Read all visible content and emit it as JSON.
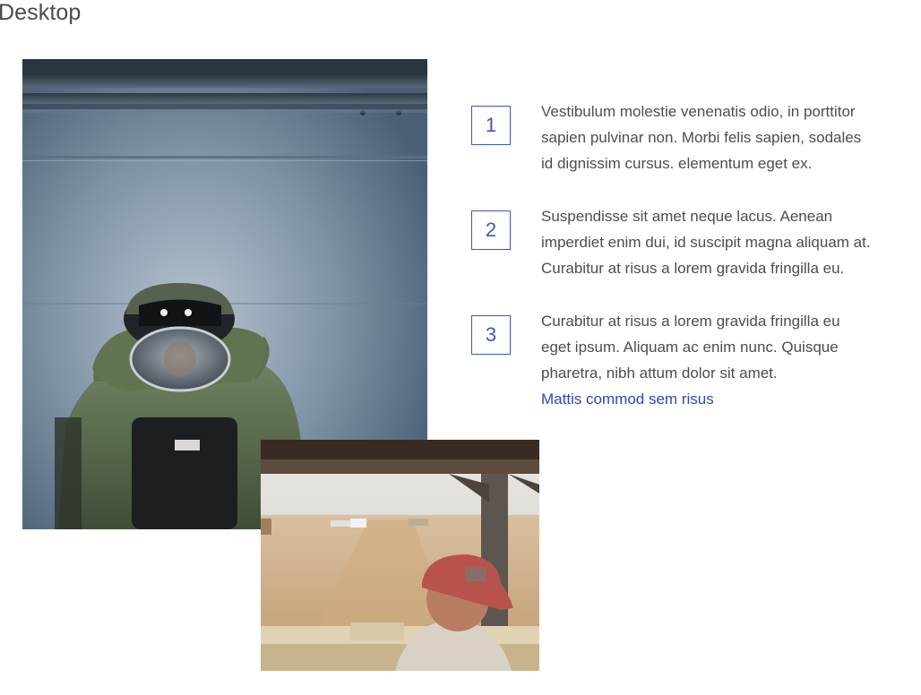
{
  "page": {
    "heading": "Desktop"
  },
  "steps": [
    {
      "number": "1",
      "lines": [
        "Vestibulum molestie venenatis odio, in porttitor",
        "sapien pulvinar non. Morbi felis sapien, sodales",
        "id dignissim cursus. elementum eget ex."
      ]
    },
    {
      "number": "2",
      "lines": [
        "Suspendisse sit amet neque lacus. Aenean",
        "imperdiet enim dui, id suscipit magna aliquam at.",
        "Curabitur at risus a lorem gravida fringilla eu."
      ]
    },
    {
      "number": "3",
      "lines": [
        "Curabitur at risus a lorem gravida fringilla eu",
        "eget ipsum. Aliquam ac enim nunc. Quisque",
        "pharetra, nibh attum dolor sit amet."
      ],
      "link": "Mattis commod sem risus"
    }
  ],
  "images": {
    "main": "bomb-disposal-suit-photo",
    "secondary": "desert-road-worker-photo"
  },
  "colors": {
    "accent": "#3a56c4",
    "link": "#2b48b8",
    "text": "#4d4d4d",
    "heading": "#4a4a4a"
  }
}
